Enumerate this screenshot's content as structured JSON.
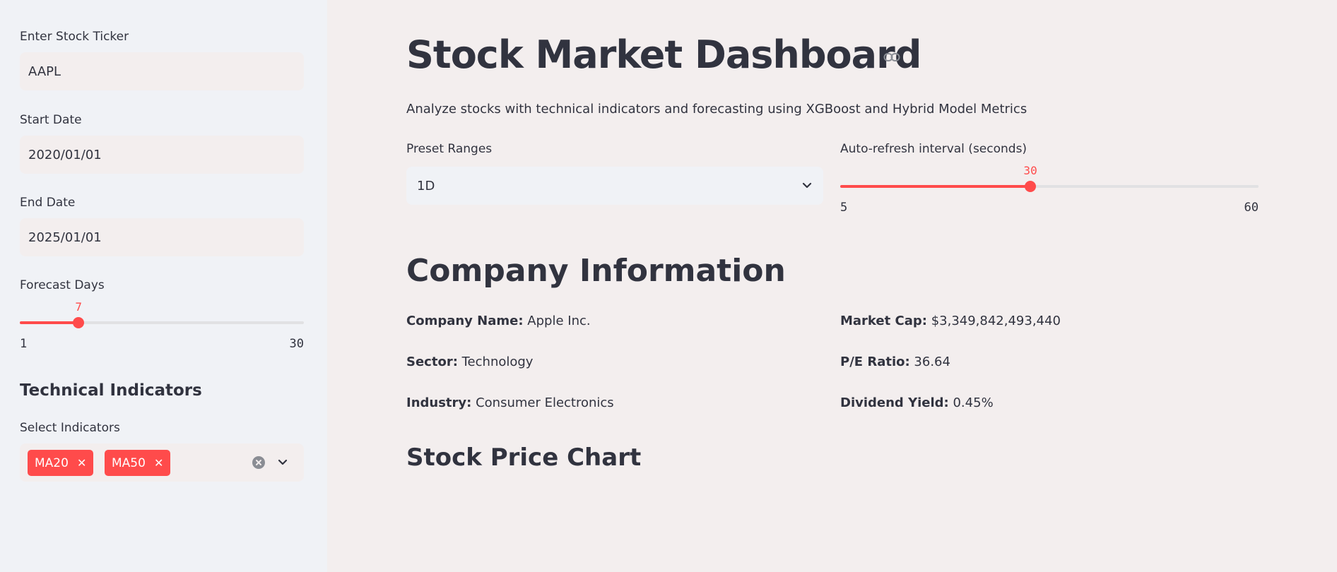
{
  "sidebar": {
    "ticker": {
      "label": "Enter Stock Ticker",
      "value": "AAPL"
    },
    "start_date": {
      "label": "Start Date",
      "value": "2020/01/01"
    },
    "end_date": {
      "label": "End Date",
      "value": "2025/01/01"
    },
    "forecast": {
      "label": "Forecast Days",
      "value": "7",
      "min": "1",
      "max": "30",
      "fraction": 0.2069
    },
    "tech_heading": "Technical Indicators",
    "indicators": {
      "label": "Select Indicators",
      "tags": [
        "MA20",
        "MA50"
      ]
    }
  },
  "main": {
    "title": "Stock Market Dashboard",
    "subtitle": "Analyze stocks with technical indicators and forecasting using XGBoost and Hybrid Model Metrics",
    "preset": {
      "label": "Preset Ranges",
      "value": "1D"
    },
    "refresh": {
      "label": "Auto-refresh interval (seconds)",
      "value": "30",
      "min": "5",
      "max": "60",
      "fraction": 0.4545
    },
    "company_heading": "Company Information",
    "info": {
      "name_label": "Company Name:",
      "name_value": "Apple Inc.",
      "sector_label": "Sector:",
      "sector_value": "Technology",
      "industry_label": "Industry:",
      "industry_value": "Consumer Electronics",
      "marketcap_label": "Market Cap:",
      "marketcap_value": "$3,349,842,493,440",
      "pe_label": "P/E Ratio:",
      "pe_value": "36.64",
      "dividend_label": "Dividend Yield:",
      "dividend_value": "0.45%"
    },
    "chart_heading": "Stock Price Chart"
  },
  "colors": {
    "accent": "#ff4b4b",
    "sidebar_bg": "#f0f2f6",
    "main_bg": "#f3eeee",
    "text": "#31333f"
  },
  "icons": {
    "link": "link-icon",
    "chevron": "chevron-down-icon",
    "clear": "clear-icon"
  }
}
